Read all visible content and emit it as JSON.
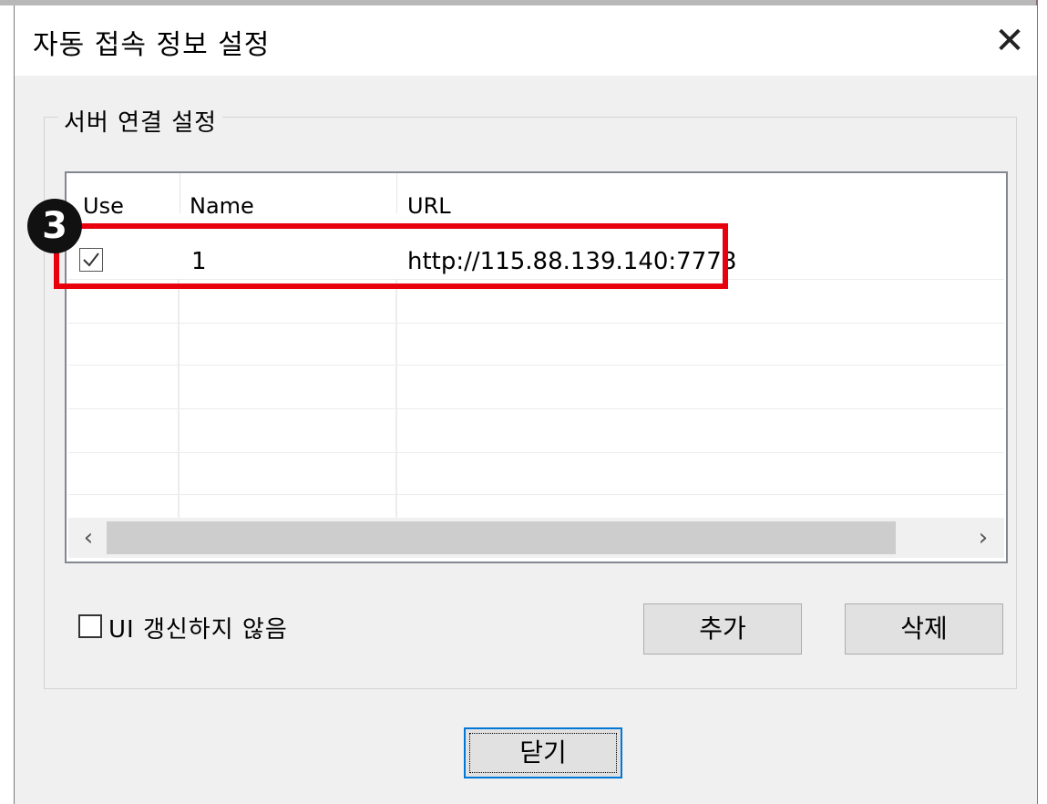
{
  "dialog": {
    "title": "자동 접속 정보 설정",
    "close_glyph": "✕"
  },
  "group": {
    "label": "서버 연결 설정"
  },
  "list": {
    "headers": [
      "Use",
      "Name",
      "URL"
    ],
    "rows": [
      {
        "use": true,
        "name": "1",
        "url": "http://115.88.139.140:7778"
      }
    ],
    "scroll_left_glyph": "‹",
    "scroll_right_glyph": "›"
  },
  "annotation": {
    "step_number": "3",
    "highlight_color": "#e8000d"
  },
  "options": {
    "no_ui_refresh_label": "UI 갱신하지 않음",
    "no_ui_refresh_checked": false
  },
  "buttons": {
    "add": "추가",
    "delete": "삭제",
    "close": "닫기"
  },
  "colors": {
    "dialog_bg": "#f0f0f0",
    "focus_border": "#0078d7"
  }
}
